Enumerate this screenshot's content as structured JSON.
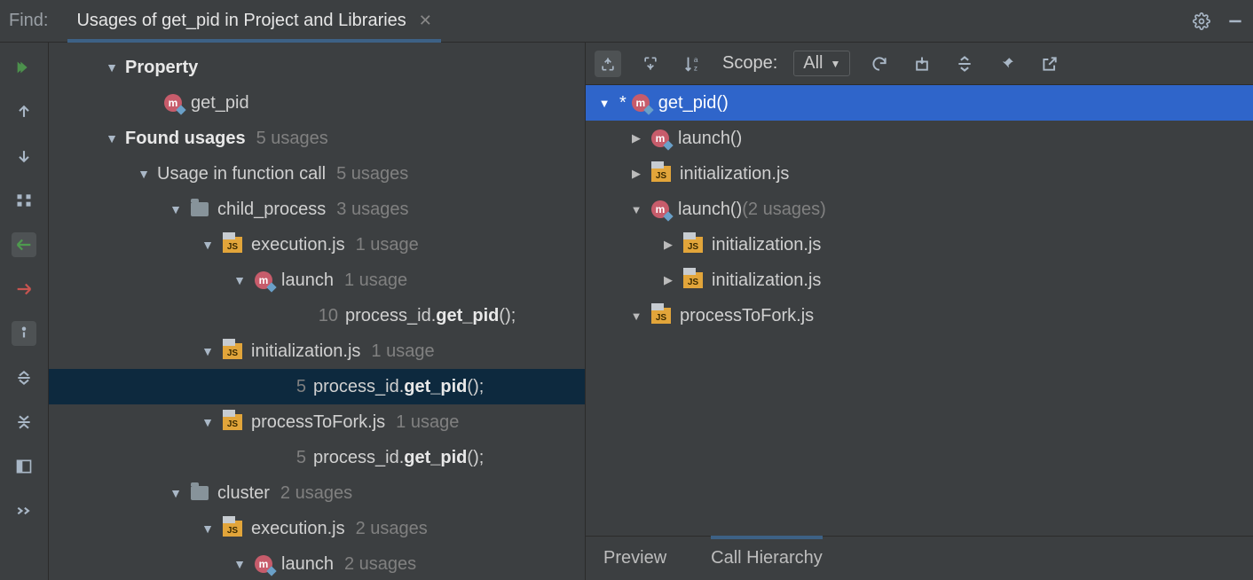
{
  "header": {
    "find_label": "Find:",
    "tab_title": "Usages of get_pid in Project and Libraries"
  },
  "left_tree": {
    "property": {
      "label": "Property",
      "item": "get_pid"
    },
    "found": {
      "label": "Found usages",
      "count": "5 usages"
    },
    "ufc": {
      "label": "Usage in function call",
      "count": "5 usages"
    },
    "group1": {
      "name": "child_process",
      "count": "3 usages"
    },
    "g1f1": {
      "name": "execution.js",
      "count": "1 usage"
    },
    "g1f1m": {
      "name": "launch",
      "count": "1 usage"
    },
    "g1f1m_line": {
      "no": "10",
      "pre": "process_id.",
      "bold": "get_pid",
      "post": "();"
    },
    "g1f2": {
      "name": "initialization.js",
      "count": "1 usage"
    },
    "g1f2_line": {
      "no": "5",
      "pre": "process_id.",
      "bold": "get_pid",
      "post": "();"
    },
    "g1f3": {
      "name": "processToFork.js",
      "count": "1 usage"
    },
    "g1f3_line": {
      "no": "5",
      "pre": "process_id.",
      "bold": "get_pid",
      "post": "();"
    },
    "group2": {
      "name": "cluster",
      "count": "2 usages"
    },
    "g2f1": {
      "name": "execution.js",
      "count": "2 usages"
    },
    "g2f1m": {
      "name": "launch",
      "count": "2 usages"
    }
  },
  "right_toolbar": {
    "scope_label": "Scope:",
    "scope_value": "All"
  },
  "right_tree": {
    "root": {
      "star": "*",
      "name": "get_pid()"
    },
    "i1": "launch()",
    "i2": "initialization.js",
    "i3": {
      "name": "launch()",
      "count": "(2 usages)"
    },
    "i3a": "initialization.js",
    "i3b": "initialization.js",
    "i4": "processToFork.js"
  },
  "right_tabs": {
    "preview": "Preview",
    "hierarchy": "Call Hierarchy"
  }
}
